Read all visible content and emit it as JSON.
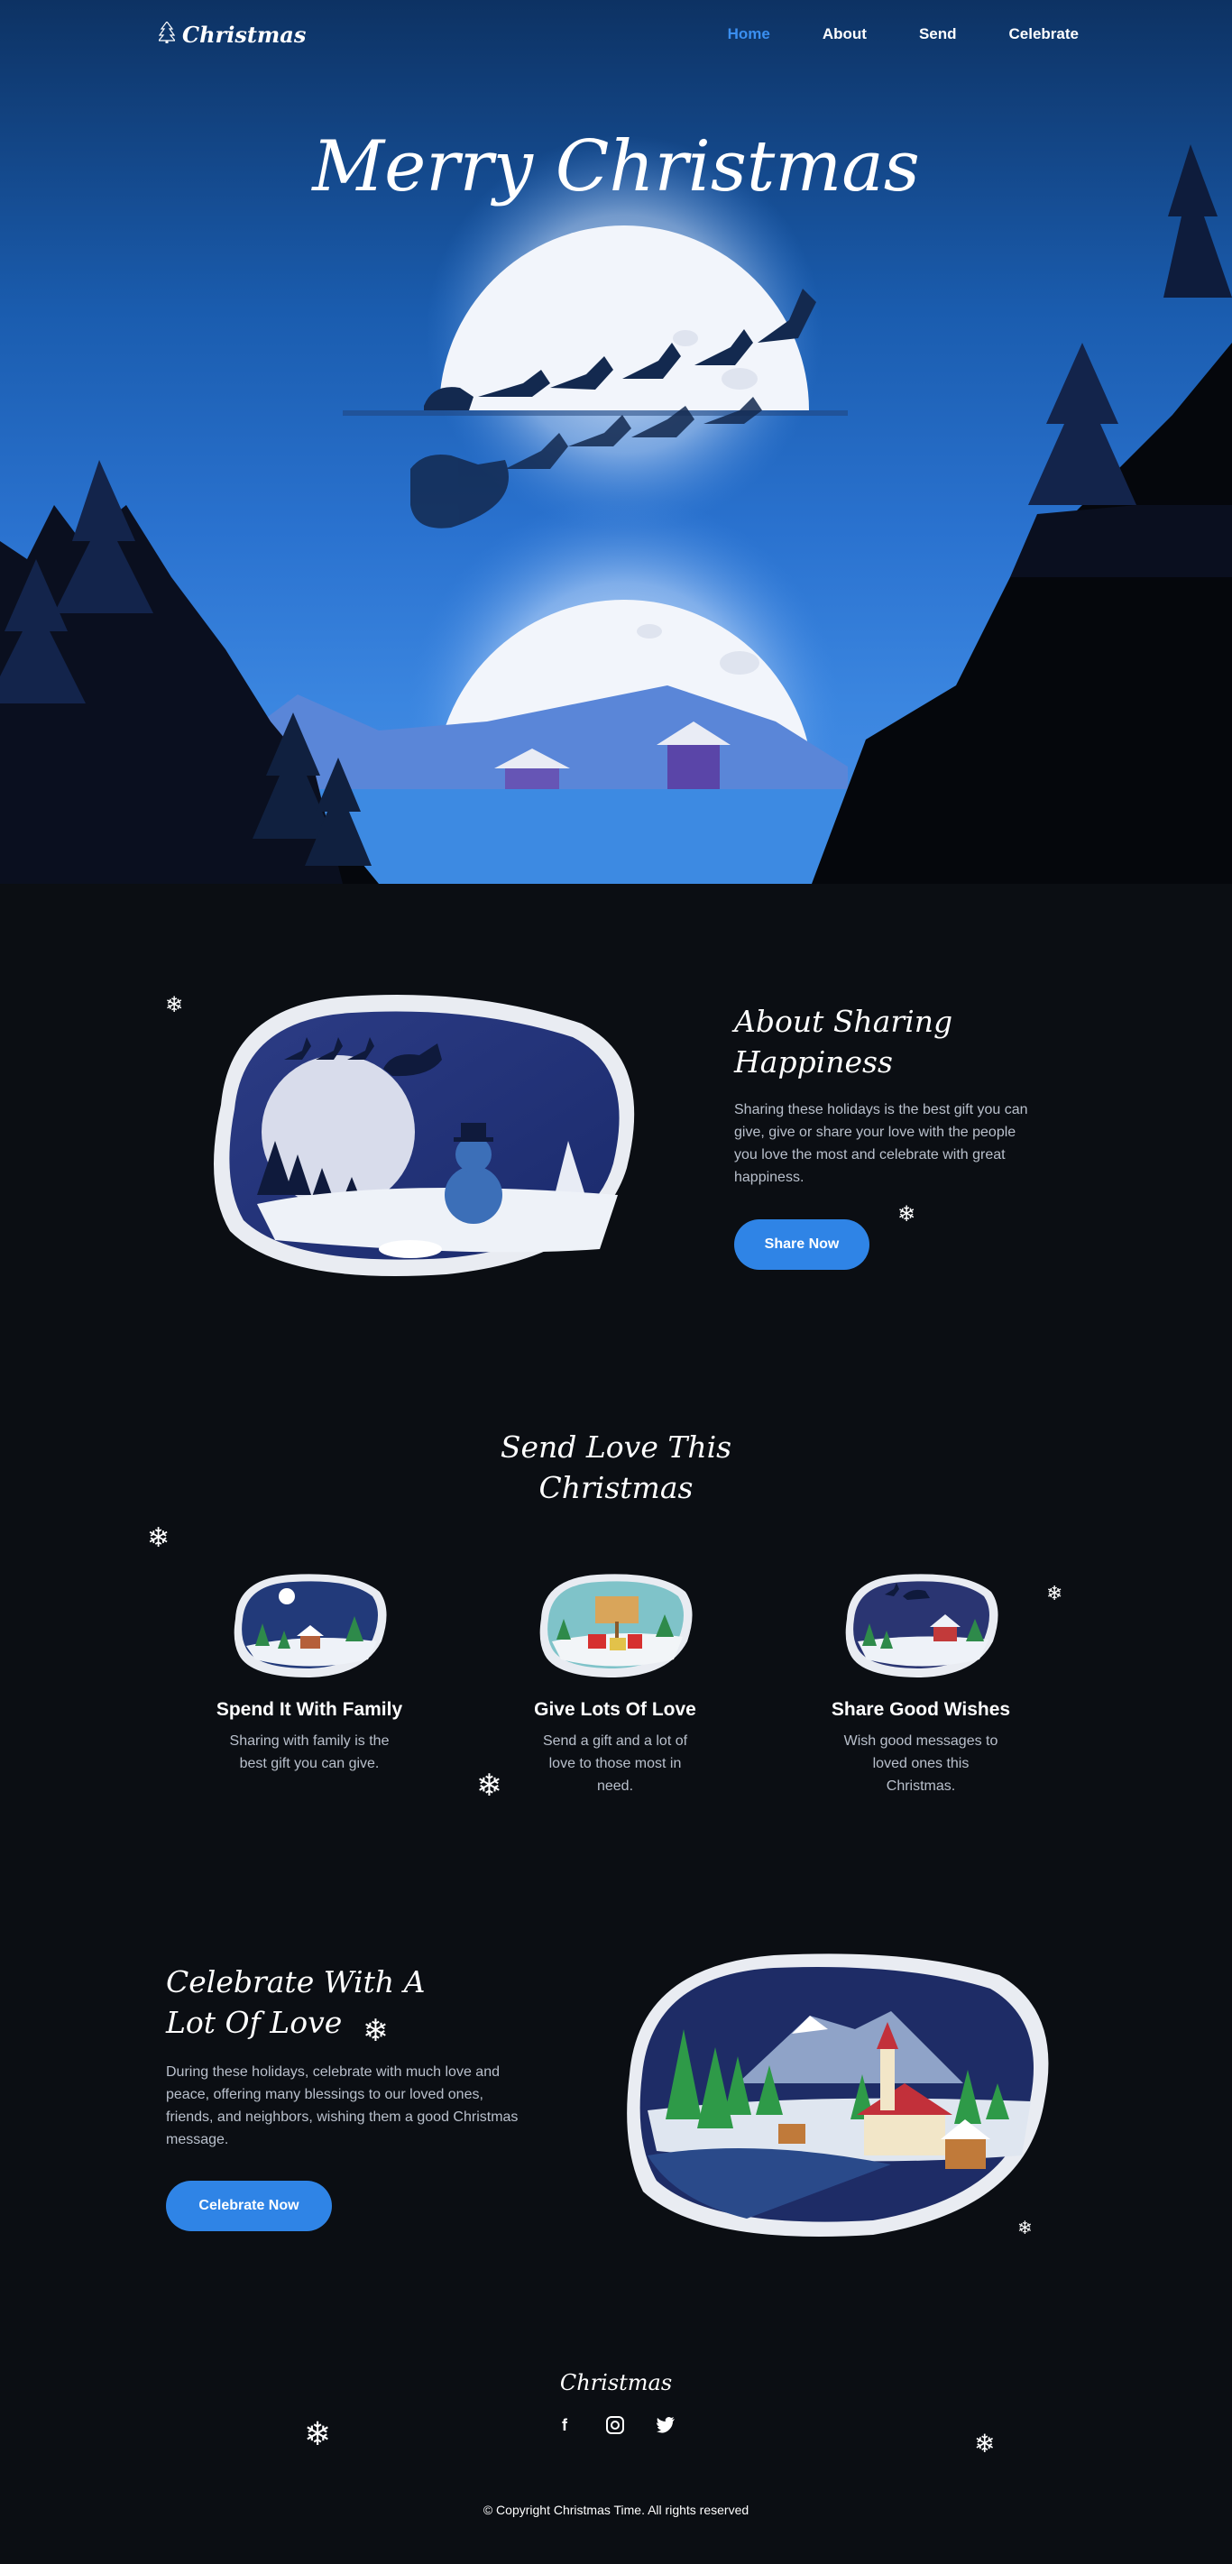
{
  "nav": {
    "logo_text": "Christmas",
    "items": [
      {
        "label": "Home",
        "active": true
      },
      {
        "label": "About",
        "active": false
      },
      {
        "label": "Send",
        "active": false
      },
      {
        "label": "Celebrate",
        "active": false
      }
    ]
  },
  "hero": {
    "title": "Merry Christmas"
  },
  "about": {
    "title_line1": "About Sharing",
    "title_line2": "Happiness",
    "text": "Sharing these holidays is the best gift you can give, give or share your love with the people you love the most and celebrate with great happiness.",
    "button": "Share Now"
  },
  "send": {
    "title_line1": "Send Love This",
    "title_line2": "Christmas",
    "cards": [
      {
        "title": "Spend It With Family",
        "text": "Sharing with family is the best gift you can give."
      },
      {
        "title": "Give Lots Of Love",
        "text": "Send a gift and a lot of love to those most in need."
      },
      {
        "title": "Share Good Wishes",
        "text": "Wish good messages to loved ones this Christmas."
      }
    ]
  },
  "celebrate": {
    "title_line1": "Celebrate With A",
    "title_line2": "Lot Of Love",
    "text": "During these holidays, celebrate with much love and peace, offering many blessings to our loved ones, friends, and neighbors, wishing them a good Christmas message.",
    "button": "Celebrate Now"
  },
  "footer": {
    "logo_text": "Christmas",
    "social": [
      "facebook-icon",
      "instagram-icon",
      "twitter-icon"
    ],
    "copyright": "© Copyright Christmas Time. All rights reserved"
  },
  "colors": {
    "accent": "#2f84e6",
    "background": "#0b0e13",
    "active_nav": "#3a8ff0"
  }
}
